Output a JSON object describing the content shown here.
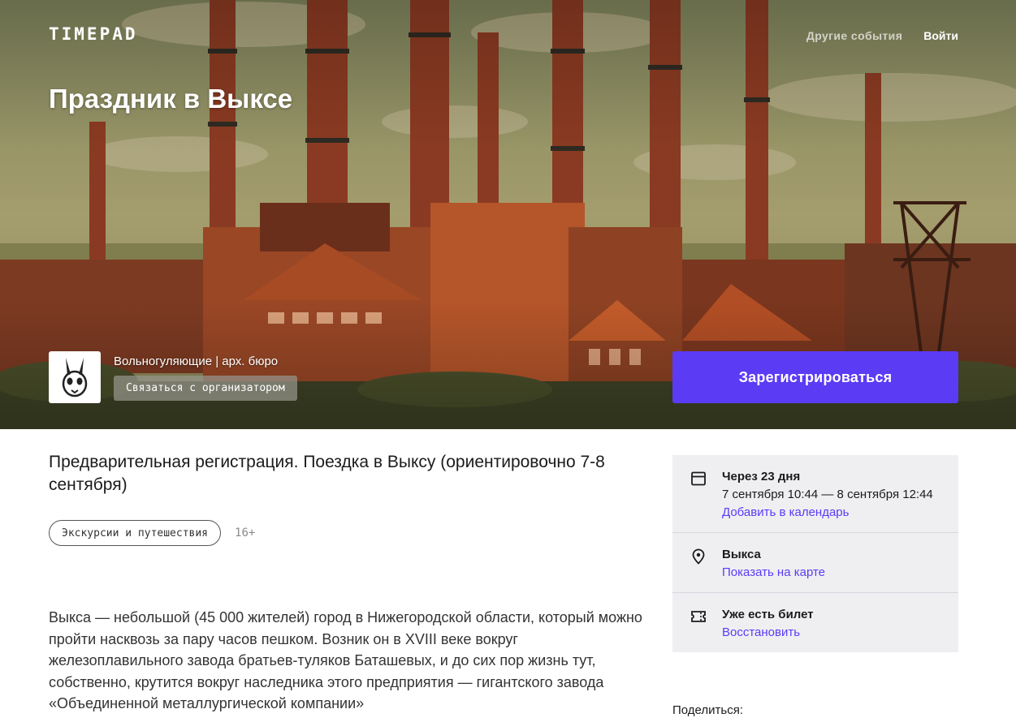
{
  "header": {
    "logo_text": "TIMEPAD",
    "nav_other_events": "Другие события",
    "nav_login": "Войти"
  },
  "hero": {
    "title": "Праздник в Выксе",
    "organizer_name": "Вольногуляющие | арх. бюро",
    "contact_label": "Связаться с организатором",
    "register_label": "Зарегистрироваться"
  },
  "event": {
    "subtitle": "Предварительная регистрация. Поездка в Выксу (ориентировочно 7-8 сентября)",
    "tag": "Экскурсии и путешествия",
    "age": "16+",
    "description": "Выкса — небольшой (45 000 жителей) город в Нижегородской области, который можно пройти насквозь за пару часов пешком. Возник он в XVIII веке вокруг железоплавильного завода братьев-туляков Баташевых, и до сих пор жизнь тут, собственно, крутится вокруг наследника этого предприятия — гигантского завода «Объединенной металлургической компании»"
  },
  "sidebar": {
    "date_title": "Через 23 дня",
    "date_range": "7 сентября 10:44 — 8 сентября 12:44",
    "date_link": "Добавить в календарь",
    "place_title": "Выкса",
    "place_link": "Показать на карте",
    "ticket_title": "Уже есть билет",
    "ticket_link": "Восстановить"
  },
  "share_label": "Поделиться:",
  "colors": {
    "accent": "#5c3bf5",
    "sidebar_bg": "#efeff2"
  },
  "icons": {
    "date": "calendar-icon",
    "place": "map-pin-icon",
    "ticket": "ticket-icon",
    "avatar": "rabbit-logo-icon"
  }
}
